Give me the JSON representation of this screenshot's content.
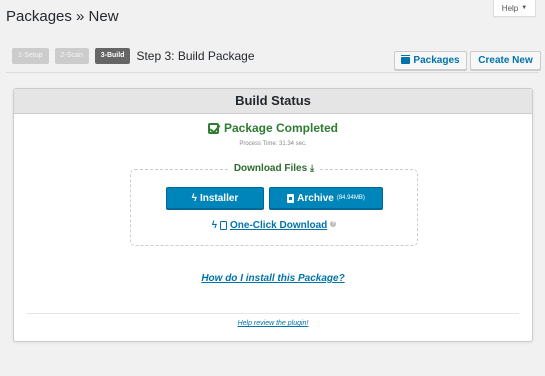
{
  "page": {
    "title": "Packages » New"
  },
  "help": {
    "label": "Help",
    "caret": "▼"
  },
  "steps": [
    {
      "label": "1-Setup",
      "active": false
    },
    {
      "label": "2-Scan",
      "active": false
    },
    {
      "label": "3-Build",
      "active": true
    }
  ],
  "step_title": "Step 3: Build Package",
  "toolbar": {
    "packages_label": "Packages",
    "create_new_label": "Create New"
  },
  "panel": {
    "heading": "Build Status",
    "status": "Package Completed",
    "process_time": "Process Time: 31.34 sec.",
    "download_label": "Download Files",
    "installer_label": "Installer",
    "archive_label": "Archive",
    "archive_size": "(84.94MB)",
    "oneclick_label": "One-Click Download",
    "howto_label": "How do I install this Package?",
    "review_label": "Help review the plugin!"
  },
  "colors": {
    "accent": "#0085ba",
    "link": "#0073aa",
    "success": "#2e7d32"
  }
}
